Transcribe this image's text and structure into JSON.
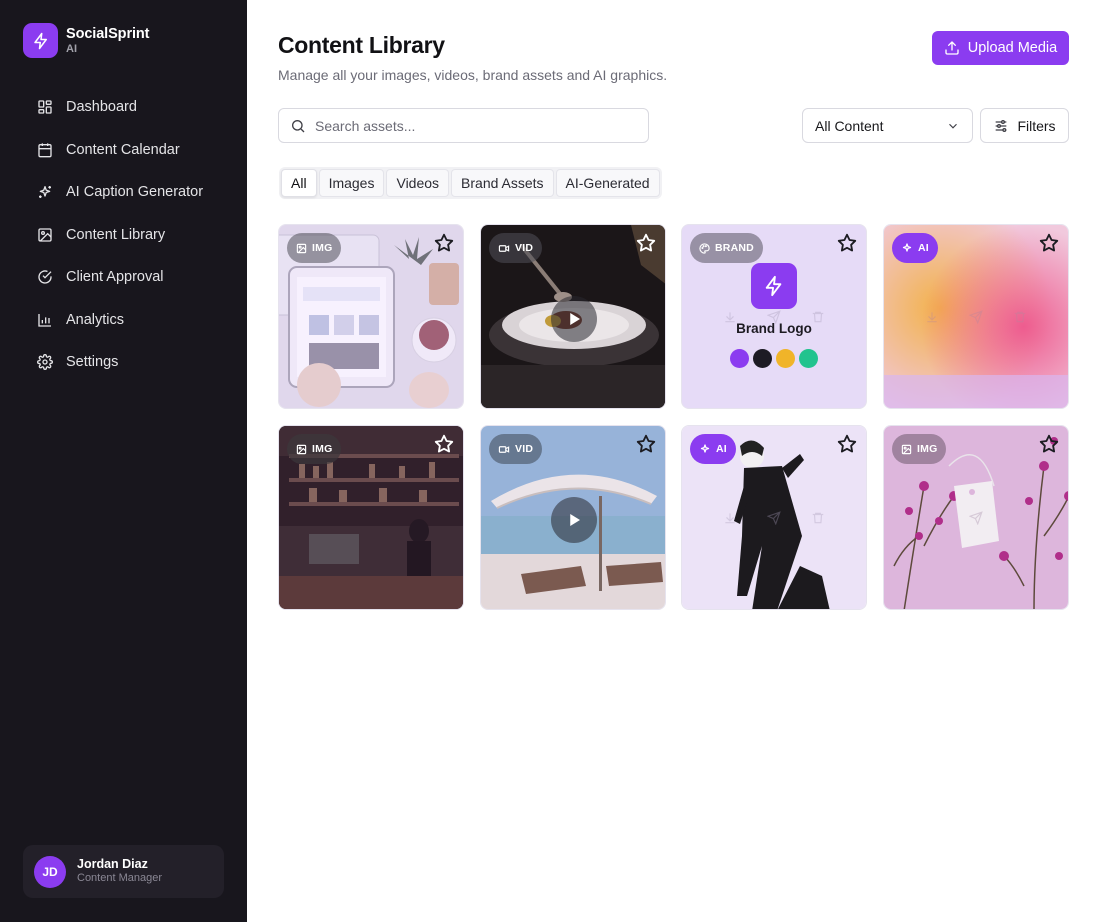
{
  "app": {
    "name": "SocialSprint",
    "sub": "AI"
  },
  "sidebar": {
    "items": [
      {
        "label": "Dashboard",
        "icon": "dashboard-icon"
      },
      {
        "label": "Content Calendar",
        "icon": "calendar-icon"
      },
      {
        "label": "AI Caption Generator",
        "icon": "sparkles-icon"
      },
      {
        "label": "Content Library",
        "icon": "image-icon"
      },
      {
        "label": "Client Approval",
        "icon": "check-circle-icon"
      },
      {
        "label": "Analytics",
        "icon": "bar-chart-icon"
      },
      {
        "label": "Settings",
        "icon": "gear-icon"
      }
    ],
    "user": {
      "initials": "JD",
      "name": "Jordan Diaz",
      "role": "Content Manager"
    }
  },
  "header": {
    "title": "Content Library",
    "subtitle": "Manage all your images, videos, brand assets and AI graphics.",
    "upload_label": "Upload Media"
  },
  "toolbar": {
    "search_placeholder": "Search assets...",
    "select_value": "All Content",
    "filters_label": "Filters"
  },
  "tabs": [
    "All",
    "Images",
    "Videos",
    "Brand Assets",
    "AI-Generated"
  ],
  "active_tab": "All",
  "assets": [
    {
      "badge": "IMG",
      "kind": "image",
      "subject": "tablet-and-tea"
    },
    {
      "badge": "VID",
      "kind": "video",
      "subject": "plated-dish"
    },
    {
      "badge": "BRAND",
      "kind": "brand",
      "label": "Brand Logo",
      "colors": [
        "#8b3cf0",
        "#1d1b24",
        "#f0b429",
        "#22c38e"
      ]
    },
    {
      "badge": "AI",
      "kind": "ai",
      "subject": "gradient"
    },
    {
      "badge": "IMG",
      "kind": "image",
      "subject": "coffee-shop"
    },
    {
      "badge": "VID",
      "kind": "video",
      "subject": "beach-umbrella"
    },
    {
      "badge": "AI",
      "kind": "ai",
      "subject": "fashion-figure"
    },
    {
      "badge": "IMG",
      "kind": "image",
      "subject": "flowers-and-tag"
    }
  ],
  "colors": {
    "accent": "#8b3cf0",
    "sidebar_bg": "#18161d"
  }
}
